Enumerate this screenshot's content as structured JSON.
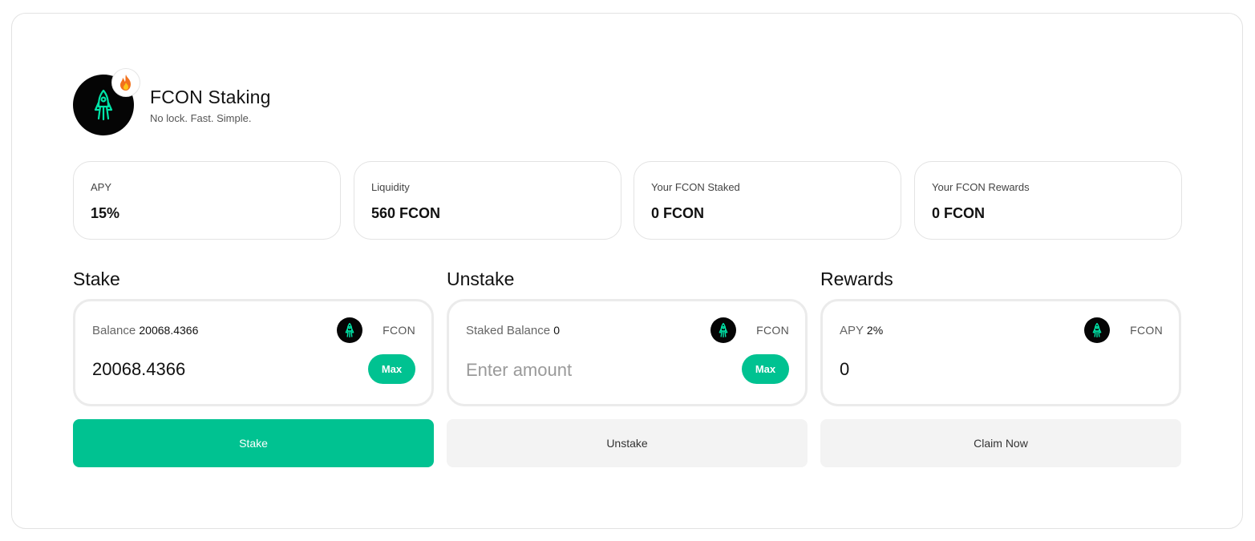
{
  "header": {
    "title": "FCON Staking",
    "subtitle": "No lock. Fast. Simple."
  },
  "colors": {
    "accent": "#00c291",
    "logo_bg": "#050505",
    "logo_glyph": "#00e5a8"
  },
  "stats": [
    {
      "label": "APY",
      "value": "15%"
    },
    {
      "label": "Liquidity",
      "value": "560 FCON"
    },
    {
      "label": "Your FCON Staked",
      "value": "0 FCON"
    },
    {
      "label": "Your FCON Rewards",
      "value": "0 FCON"
    }
  ],
  "stake": {
    "section_title": "Stake",
    "balance_label": "Balance",
    "balance_value": "20068.4366",
    "token": "FCON",
    "amount": "20068.4366",
    "max_label": "Max",
    "button_label": "Stake"
  },
  "unstake": {
    "section_title": "Unstake",
    "balance_label": "Staked Balance",
    "balance_value": "0",
    "token": "FCON",
    "placeholder": "Enter amount",
    "max_label": "Max",
    "button_label": "Unstake"
  },
  "rewards": {
    "section_title": "Rewards",
    "apy_label": "APY",
    "apy_value": "2%",
    "token": "FCON",
    "amount": "0",
    "button_label": "Claim Now"
  },
  "icons": {
    "logo": "fcon-rocket-logo-icon",
    "badge": "fire-icon",
    "token": "fcon-token-icon"
  }
}
